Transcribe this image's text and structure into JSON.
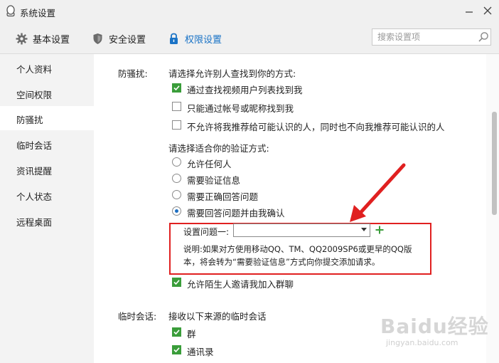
{
  "window": {
    "title": "系统设置"
  },
  "tabs": [
    {
      "label": "基本设置",
      "icon": "gear-icon",
      "active": false
    },
    {
      "label": "安全设置",
      "icon": "shield-icon",
      "active": false
    },
    {
      "label": "权限设置",
      "icon": "lock-icon",
      "active": true
    }
  ],
  "search": {
    "placeholder": "搜索设置项"
  },
  "sidebar": {
    "items": [
      {
        "label": "个人资料"
      },
      {
        "label": "空间权限"
      },
      {
        "label": "防骚扰",
        "active": true
      },
      {
        "label": "临时会话"
      },
      {
        "label": "资讯提醒"
      },
      {
        "label": "个人状态"
      },
      {
        "label": "远程桌面"
      }
    ]
  },
  "anti_harass": {
    "section_label": "防骚扰:",
    "find_prompt": "请选择允许别人查找到你的方式:",
    "find_options": [
      {
        "label": "通过查找视频用户列表找到我",
        "checked": true
      },
      {
        "label": "只能通过帐号或昵称找到我",
        "checked": false
      },
      {
        "label": "不允许将我推荐给可能认识的人，同时也不向我推荐可能认识的人",
        "checked": false
      }
    ],
    "verify_prompt": "请选择适合你的验证方式:",
    "verify_options": [
      {
        "label": "允许任何人",
        "selected": false
      },
      {
        "label": "需要验证信息",
        "selected": false
      },
      {
        "label": "需要正确回答问题",
        "selected": false
      },
      {
        "label": "需要回答问题并由我确认",
        "selected": true
      }
    ],
    "question_label": "设置问题一:",
    "question_value": "",
    "note": "说明:如果对方使用移动QQ、TM、QQ2009SP6或更早的QQ版本，将会转为“需要验证信息”方式向你提交添加请求。",
    "group_invite": {
      "label": "允许陌生人邀请我加入群聊",
      "checked": true
    }
  },
  "temp_session": {
    "section_label": "临时会话:",
    "prompt": "接收以下来源的临时会话",
    "options": [
      {
        "label": "群",
        "checked": true
      },
      {
        "label": "通讯录",
        "checked": true
      }
    ]
  },
  "watermark": {
    "main": "Baidu经验",
    "sub": "jingyan.baidu.com"
  },
  "colors": {
    "accent": "#1a73c6",
    "check_green": "#3a9d3a",
    "highlight_red": "#e02020"
  }
}
